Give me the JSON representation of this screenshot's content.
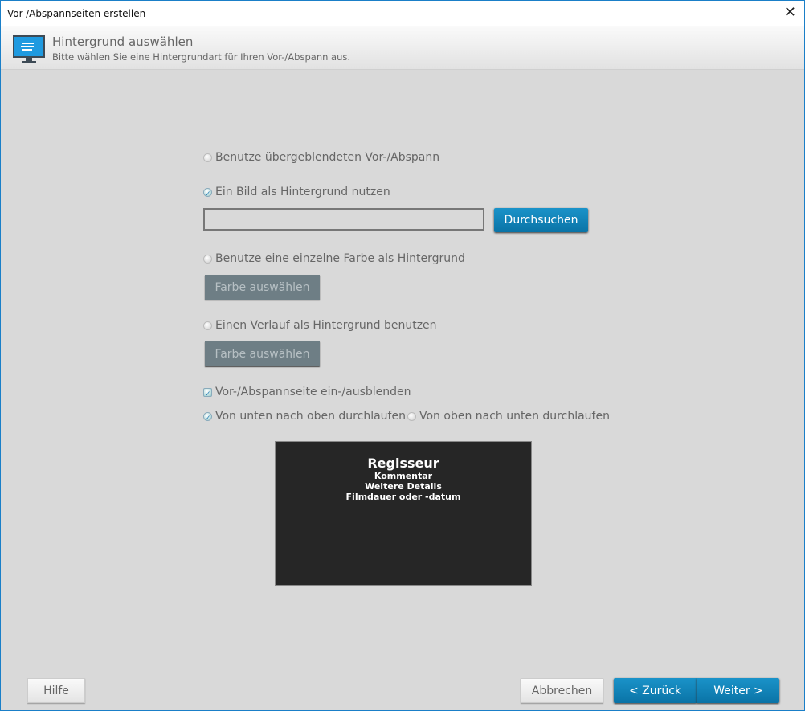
{
  "window": {
    "title": "Vor-/Abspannseiten erstellen"
  },
  "header": {
    "title": "Hintergrund auswählen",
    "subtitle": "Bitte wählen Sie eine Hintergrundart für Ihren Vor-/Abspann aus."
  },
  "options": {
    "blend": {
      "label": "Benutze übergeblendeten Vor-/Abspann",
      "checked": false
    },
    "image": {
      "label": "Ein Bild als Hintergrund nutzen",
      "checked": true,
      "path_value": "",
      "browse_label": "Durchsuchen"
    },
    "color": {
      "label": "Benutze eine einzelne Farbe als Hintergrund",
      "checked": false,
      "button": "Farbe auswählen"
    },
    "gradient": {
      "label": "Einen Verlauf als Hintergrund benutzen",
      "checked": false,
      "button": "Farbe auswählen"
    },
    "fade": {
      "label": "Vor-/Abspannseite ein-/ausblenden",
      "checked": true
    },
    "bottom_up": {
      "label": "Von unten nach oben durchlaufen",
      "checked": true
    },
    "top_down": {
      "label": "Von oben nach unten durchlaufen",
      "checked": false
    }
  },
  "preview": {
    "title": "Regisseur",
    "lines": [
      "Kommentar",
      "Weitere Details",
      "Filmdauer oder -datum"
    ]
  },
  "footer": {
    "help": "Hilfe",
    "cancel": "Abbrechen",
    "back": "< Zurück",
    "next": "Weiter >"
  }
}
